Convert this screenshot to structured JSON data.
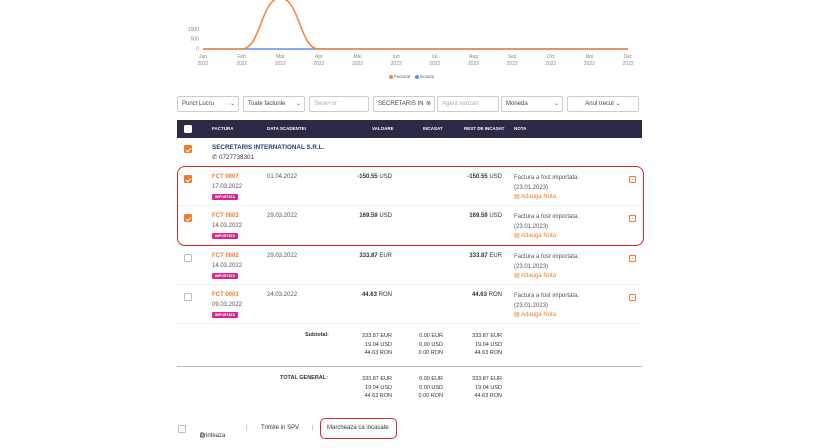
{
  "chart_data": {
    "type": "line",
    "categories": [
      "Jan 2022",
      "Feb 2022",
      "Mar 2022",
      "Apr 2022",
      "May 2022",
      "Jun 2022",
      "Jul 2022",
      "Aug 2022",
      "Sep 2022",
      "Oct 2022",
      "Nov 2022",
      "Dec 2022"
    ],
    "x_tick_months": [
      "Jan",
      "Feb",
      "Mar",
      "Apr",
      "Mai",
      "Iun",
      "Iul",
      "Aug",
      "Sep",
      "Oct",
      "Noi",
      "Dec"
    ],
    "x_tick_years": [
      "2022",
      "2022",
      "2022",
      "2022",
      "2022",
      "2022",
      "2022",
      "2022",
      "2022",
      "2022",
      "2022",
      "2022"
    ],
    "y_ticks": [
      "0",
      "500",
      "1000"
    ],
    "ylim": [
      0,
      2500
    ],
    "series": [
      {
        "name": "Facturat",
        "color": "#f0883e",
        "values": [
          0,
          0,
          2600,
          0,
          0,
          0,
          0,
          0,
          0,
          0,
          0,
          0
        ]
      },
      {
        "name": "Incasat",
        "color": "#5b8ff9",
        "values": [
          0,
          0,
          0,
          0,
          0,
          0,
          0,
          0,
          0,
          0,
          0,
          0
        ]
      }
    ],
    "legend_position": "bottom-center"
  },
  "filters": {
    "punct_lucru": "Punct Lucru",
    "toate_facturile": "Toate facturile",
    "serie_placeholder": "Serie+nr",
    "client": "SECRETARIS IN",
    "agent_placeholder": "Agent vanzari",
    "moneda": "Moneda",
    "anul": "Anul trecut"
  },
  "table": {
    "headers": [
      "FACTURA",
      "DATA SCADENTEI",
      "VALOARE",
      "INCASAT",
      "REST DE INCASAT",
      "NOTA"
    ],
    "client_name": "SECRETARIS INTERNATIONAL S.R.L.",
    "client_phone": "0727738301",
    "rows": [
      {
        "no": "FCT 0007",
        "date": "17.03.2022",
        "tag": "IMPORTATA",
        "due": "01.04.2022",
        "value": "-150.55",
        "value_cur": "USD",
        "rest": "-150.55",
        "rest_cur": "USD",
        "nota1": "Factura a fost importata.",
        "nota2": "(23.01.2023)",
        "add": "Adauga Nota",
        "checked": true
      },
      {
        "no": "FCT 0003",
        "date": "14.03.2022",
        "tag": "IMPORTATA",
        "due": "29.03.2022",
        "value": "169.59",
        "value_cur": "USD",
        "rest": "169.59",
        "rest_cur": "USD",
        "nota1": "Factura a fost importata.",
        "nota2": "(23.01.2023)",
        "add": "Adauga Nota",
        "checked": true
      },
      {
        "no": "FCT 0002",
        "date": "14.03.2022",
        "tag": "IMPORTATA",
        "due": "29.03.2022",
        "value": "333.87",
        "value_cur": "EUR",
        "rest": "333.87",
        "rest_cur": "EUR",
        "nota1": "Factura a fost importata.",
        "nota2": "(23.01.2023)",
        "add": "Adauga Nota",
        "checked": false
      },
      {
        "no": "FCT 0001",
        "date": "09.03.2022",
        "tag": "IMPORTATA",
        "due": "24.03.2022",
        "value": "44.63",
        "value_cur": "RON",
        "rest": "44.63",
        "rest_cur": "RON",
        "nota1": "Factura a fost importata.",
        "nota2": "(23.01.2023)",
        "add": "Adauga Nota",
        "checked": false
      }
    ]
  },
  "subtotal": {
    "label": "Subtotal:",
    "valoare": [
      "333.87 EUR",
      "19.04 USD",
      "44.63 RON"
    ],
    "incasat": [
      "0.00 EUR",
      "0.00 USD",
      "0.00 RON"
    ],
    "rest": [
      "333.87 EUR",
      "19.04 USD",
      "44.63 RON"
    ]
  },
  "total": {
    "label": "TOTAL GENERAL:",
    "valoare": [
      "333.87 EUR",
      "19.04 USD",
      "44.63 RON"
    ],
    "incasat": [
      "0.00 EUR",
      "0.00 USD",
      "0.00 RON"
    ],
    "rest": [
      "333.87 EUR",
      "19.04 USD",
      "44.63 RON"
    ]
  },
  "footer": {
    "print": "Printeaza",
    "spv": "Trimite in SPV",
    "mark": "Marcheaza ca incasate",
    "sep": "|"
  }
}
